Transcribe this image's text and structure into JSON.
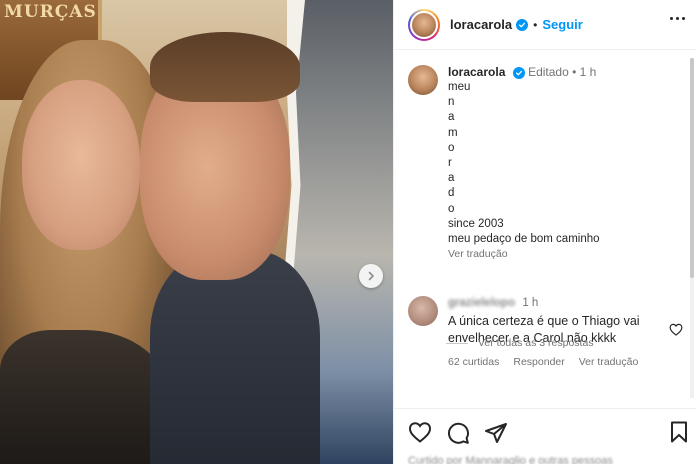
{
  "photo": {
    "sign_text": "MURÇAS",
    "next_icon": "chevron-right-icon"
  },
  "header": {
    "username": "loracarola",
    "separator": "•",
    "follow_label": "Seguir",
    "more_icon": "more-horizontal-icon"
  },
  "caption": {
    "username": "loracarola",
    "edited": "Editado",
    "separator": "•",
    "time": "1 h",
    "lines": [
      "meu",
      "n",
      "a",
      "m",
      "o",
      "r",
      "a",
      "d",
      "o",
      "since 2003",
      "meu pedaço de bom caminho"
    ],
    "translate": "Ver tradução"
  },
  "comment": {
    "username": "grazielelopo",
    "time": "1 h",
    "text": "A única certeza é que o Thiago vai envelhecer e a Carol não kkkk",
    "likes": "62 curtidas",
    "reply": "Responder",
    "translate": "Ver tradução",
    "view_replies": "Ver todas as 3 respostas"
  },
  "actions": {
    "like_icon": "heart-icon",
    "comment_icon": "comment-icon",
    "share_icon": "share-icon",
    "save_icon": "bookmark-icon",
    "liked_by": "Curtido por Mannaraglio e outras pessoas"
  },
  "colors": {
    "accent": "#0095f6",
    "text": "#262626",
    "muted": "#737373"
  }
}
